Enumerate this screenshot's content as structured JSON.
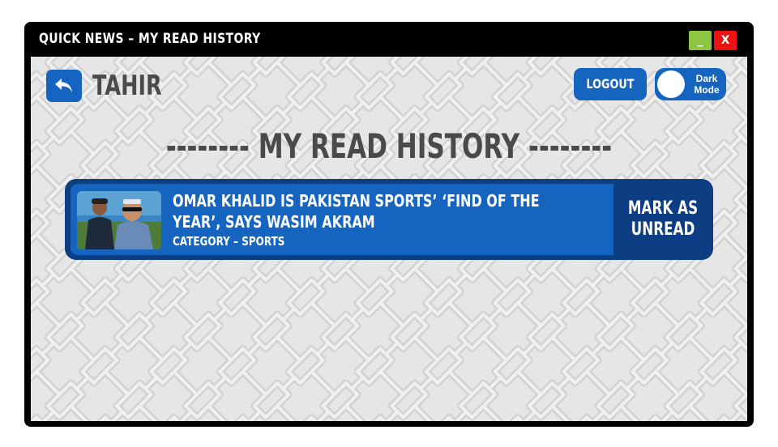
{
  "window": {
    "title": "QUICK NEWS – MY READ HISTORY",
    "minimize_label": "_",
    "close_label": "X"
  },
  "header": {
    "back_icon": "back-arrow-icon",
    "username": "TAHIR",
    "logout_label": "LOGOUT",
    "dark_mode_label_line1": "Dark",
    "dark_mode_label_line2": "Mode",
    "dark_mode_on": false
  },
  "main": {
    "heading": "-------- MY READ HISTORY --------",
    "news_items": [
      {
        "headline": "OMAR KHALID IS PAKISTAN SPORTS’ ‘FIND OF THE YEAR’, SAYS WASIM AKRAM",
        "category": "CATEGORY – SPORTS",
        "action_label": "MARK AS UNREAD"
      }
    ]
  },
  "colors": {
    "accent_blue": "#1565c0",
    "card_dark_blue": "#0d3d82",
    "minimize_green": "#8cc63f",
    "close_red": "#ee1111",
    "heading_gray": "#4a4a4a"
  }
}
